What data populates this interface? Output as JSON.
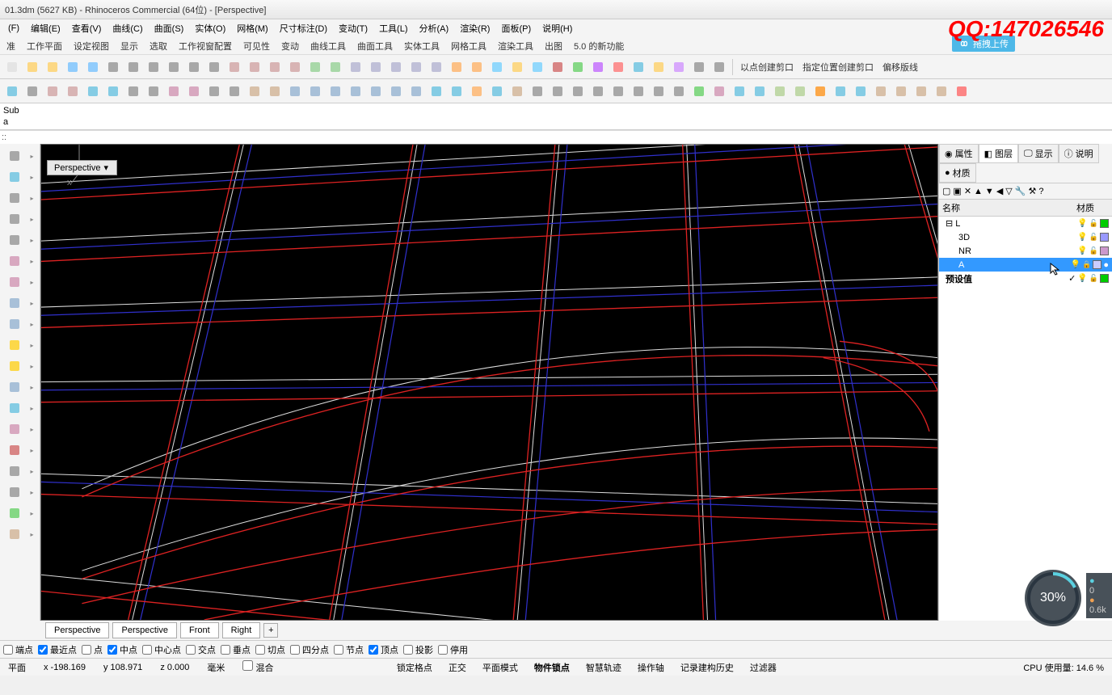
{
  "title": "01.3dm (5627 KB) - Rhinoceros Commercial (64位) - [Perspective]",
  "watermark": "QQ:147026546",
  "upload_badge": "拖拽上传",
  "menu": [
    "(F)",
    "编辑(E)",
    "查看(V)",
    "曲线(C)",
    "曲面(S)",
    "实体(O)",
    "网格(M)",
    "尺寸标注(D)",
    "变动(T)",
    "工具(L)",
    "分析(A)",
    "渲染(R)",
    "面板(P)",
    "说明(H)"
  ],
  "toolbar_groups": [
    "准",
    "工作平面",
    "设定视图",
    "显示",
    "选取",
    "工作视窗配置",
    "可见性",
    "变动",
    "曲线工具",
    "曲面工具",
    "实体工具",
    "网格工具",
    "渲染工具",
    "出图",
    "5.0 的新功能"
  ],
  "context_actions": [
    "以点创建剪口",
    "指定位置创建剪口",
    "偏移版线"
  ],
  "command_lines": [
    "Sub",
    "a"
  ],
  "prompt_prefix": "::",
  "viewport_name": "Perspective",
  "panel_tabs": [
    {
      "label": "属性",
      "icon": "circle"
    },
    {
      "label": "图层",
      "icon": "layers",
      "active": true
    },
    {
      "label": "显示",
      "icon": "monitor"
    },
    {
      "label": "说明",
      "icon": "info"
    },
    {
      "label": "材质",
      "icon": "sphere"
    }
  ],
  "layer_header": {
    "name": "名称",
    "material": "材质"
  },
  "layers": [
    {
      "name": "L",
      "indent": 0,
      "expand": "−",
      "color": "#00cc00",
      "visible": true,
      "locked": false
    },
    {
      "name": "3D",
      "indent": 1,
      "color": "#9999ff",
      "visible": true,
      "locked": false
    },
    {
      "name": "NR",
      "indent": 1,
      "color": "#cc99cc",
      "visible": true,
      "locked": false
    },
    {
      "name": "A",
      "indent": 1,
      "color": "#ccccff",
      "selected": true,
      "visible": true,
      "locked": true,
      "current": true
    },
    {
      "name": "预设值",
      "indent": 0,
      "color": "#00cc00",
      "check": true,
      "bold": true
    }
  ],
  "view_tabs": [
    "Perspective",
    "Perspective",
    "Front",
    "Right"
  ],
  "osnaps": [
    {
      "label": "端点",
      "checked": false
    },
    {
      "label": "最近点",
      "checked": true
    },
    {
      "label": "点",
      "checked": false
    },
    {
      "label": "中点",
      "checked": true
    },
    {
      "label": "中心点",
      "checked": false
    },
    {
      "label": "交点",
      "checked": false
    },
    {
      "label": "垂点",
      "checked": false
    },
    {
      "label": "切点",
      "checked": false
    },
    {
      "label": "四分点",
      "checked": false
    },
    {
      "label": "节点",
      "checked": false
    },
    {
      "label": "顶点",
      "checked": true
    },
    {
      "label": "投影",
      "checked": false
    },
    {
      "label": "停用",
      "checked": false
    }
  ],
  "status": {
    "plane": "平面",
    "x": "x -198.169",
    "y": "y 108.971",
    "z": "z 0.000",
    "unit": "毫米",
    "blend_label": "混合",
    "items": [
      "锁定格点",
      "正交",
      "平面模式",
      "物件锁点",
      "智慧轨迹",
      "操作轴",
      "记录建构历史",
      "过滤器"
    ],
    "cpu": "CPU 使用量: 14.6 %"
  },
  "gauge": {
    "percent": "30%",
    "r1": "0",
    "r2": "0.6k"
  }
}
